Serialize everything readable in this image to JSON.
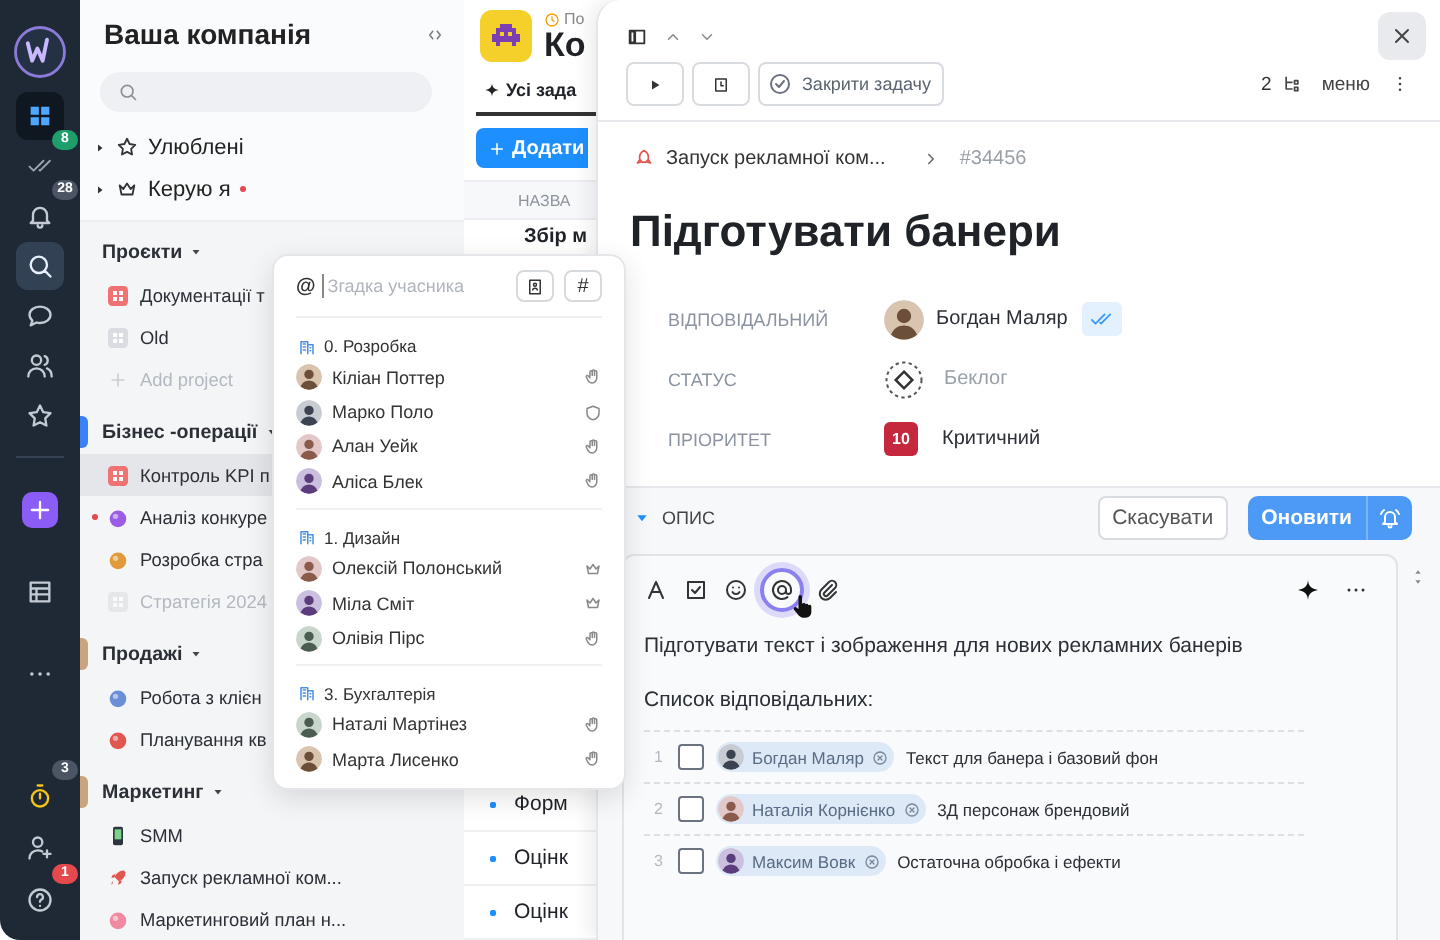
{
  "rail": {
    "top": [
      {
        "kind": "grid",
        "selected": true
      },
      {
        "kind": "tasks",
        "selected": false,
        "badge": {
          "text": "8",
          "color": "#1e9e6a"
        }
      },
      {
        "kind": "bell",
        "selected": false,
        "badge": {
          "text": "28",
          "color": "#4b5563"
        }
      },
      {
        "kind": "search",
        "selected": true
      },
      {
        "kind": "chat",
        "selected": false
      },
      {
        "kind": "people",
        "selected": false
      },
      {
        "kind": "star",
        "selected": false
      }
    ],
    "middle": [
      {
        "kind": "create",
        "selected": false
      },
      {
        "kind": "table",
        "selected": false
      },
      {
        "kind": "more",
        "selected": false
      }
    ],
    "bottom": [
      {
        "kind": "timer",
        "selected": false,
        "badge": {
          "text": "3",
          "color": "#4b5563"
        }
      },
      {
        "kind": "adduser",
        "selected": false
      },
      {
        "kind": "help",
        "selected": false,
        "badge": {
          "text": "1",
          "color": "#e5484d"
        }
      }
    ]
  },
  "sidebar": {
    "title": "Ваша компанія",
    "favorites": [
      {
        "kind": "star",
        "label": "Улюблені",
        "alert": false
      },
      {
        "kind": "crown",
        "label": "Керую я",
        "alert": true
      }
    ],
    "groups": [
      {
        "title": "Проєкти",
        "items": [
          {
            "kind": "tile",
            "label": "Документації т",
            "color": "#f07272",
            "selected": false,
            "disabled": false,
            "alert": false
          },
          {
            "kind": "tile",
            "label": "Old",
            "color": "#d9dce1",
            "selected": false,
            "disabled": false,
            "alert": false
          },
          {
            "kind": "add",
            "label": "Add project",
            "selected": false,
            "disabled": true,
            "alert": false
          }
        ]
      },
      {
        "title": "Бізнес -операції",
        "color": "#3b82f6",
        "items": [
          {
            "kind": "tile",
            "label": "Контроль KPI п",
            "color": "#f07272",
            "selected": true,
            "disabled": false,
            "alert": false
          },
          {
            "kind": "emoji",
            "label": "Аналіз конкуре",
            "color": "#9b5de5",
            "selected": false,
            "disabled": false,
            "alert": true
          },
          {
            "kind": "emoji",
            "label": "Розробка стра",
            "color": "#e09a3a",
            "selected": false,
            "disabled": false,
            "alert": false
          },
          {
            "kind": "tile",
            "label": "Стратегія 2024",
            "color": "#d9dce1",
            "selected": false,
            "disabled": true,
            "alert": false
          }
        ]
      },
      {
        "title": "Продажі",
        "color": "#c9a47e",
        "items": [
          {
            "kind": "emoji",
            "label": "Робота з клієн",
            "color": "#6b8fd6",
            "selected": false,
            "disabled": false,
            "alert": false
          },
          {
            "kind": "emoji",
            "label": "Планування кв",
            "color": "#e0574f",
            "selected": false,
            "disabled": false,
            "alert": false
          }
        ]
      },
      {
        "title": "Маркетинг",
        "color": "#c9a47e",
        "items": [
          {
            "kind": "phone",
            "label": "SMM",
            "color": "#2d3540",
            "selected": false,
            "disabled": false,
            "alert": false
          },
          {
            "kind": "rocket",
            "label": "Запуск рекламної ком...",
            "color": "#e0574f",
            "selected": false,
            "disabled": false,
            "alert": false
          },
          {
            "kind": "emoji",
            "label": "Маркетинговий план н...",
            "color": "#f08aa0",
            "selected": false,
            "disabled": false,
            "alert": false
          }
        ]
      }
    ]
  },
  "project": {
    "subtitle": "По",
    "title": "Ко",
    "tab": "Усі зада",
    "add_button": "Додати",
    "column": "НАЗВА",
    "rows": [
      {
        "kind": "task",
        "name": "Збір м"
      },
      {
        "kind": "subtask",
        "name": "Форм"
      },
      {
        "kind": "subtask",
        "name": "Оцінк"
      },
      {
        "kind": "subtask",
        "name": "Оцінк"
      }
    ]
  },
  "mention_popup": {
    "prefix": "@",
    "placeholder": "Згадка учасника",
    "hash_button": "#",
    "groups": [
      {
        "title": "0. Розробка",
        "members": [
          {
            "name": "Кіліан Поттер",
            "kind": "member"
          },
          {
            "name": "Марко Поло",
            "kind": "admin"
          },
          {
            "name": "Алан Уейк",
            "kind": "member"
          },
          {
            "name": "Аліса Блек",
            "kind": "member"
          }
        ]
      },
      {
        "title": "1. Дизайн",
        "members": [
          {
            "name": "Олексій Полонський",
            "kind": "owner"
          },
          {
            "name": "Міла Сміт",
            "kind": "owner"
          },
          {
            "name": "Олівія Пірс",
            "kind": "member"
          }
        ]
      },
      {
        "title": "3. Бухгалтерія",
        "members": [
          {
            "name": "Наталі Мартінез",
            "kind": "member"
          },
          {
            "name": "Марта Лисенко",
            "kind": "member"
          }
        ]
      }
    ]
  },
  "task": {
    "close_task_button": "Закрити задачу",
    "subtask_count": "2",
    "menu_label": "меню",
    "breadcrumb": {
      "project": "Запуск рекламної ком...",
      "id": "#34456"
    },
    "title": "Підготувати банери",
    "fields": [
      {
        "kind": "assignee",
        "label": "ВІДПОВІДАЛЬНИЙ",
        "value": "Богдан Маляр"
      },
      {
        "kind": "status",
        "label": "СТАТУС",
        "value": "Беклог"
      },
      {
        "kind": "priority",
        "label": "ПРІОРИТЕТ",
        "value": "Критичний",
        "badge": "10"
      }
    ],
    "description": {
      "title": "ОПИС",
      "expanded": true,
      "cancel_button": "Скасувати",
      "update_button": "Оновити",
      "text": "Підготувати текст і зображення для нових рекламних банерів",
      "list_title": "Список відповідальних:",
      "rows": [
        {
          "number": "1",
          "checked": false,
          "person": "Богдан Маляр",
          "task": "Текст для банера і базовий фон"
        },
        {
          "number": "2",
          "checked": false,
          "person": "Наталія Корнієнко",
          "task": "3Д персонаж брендовий"
        },
        {
          "number": "3",
          "checked": false,
          "person": "Максим Вовк",
          "task": "Остаточна обробка і ефекти"
        }
      ]
    }
  }
}
